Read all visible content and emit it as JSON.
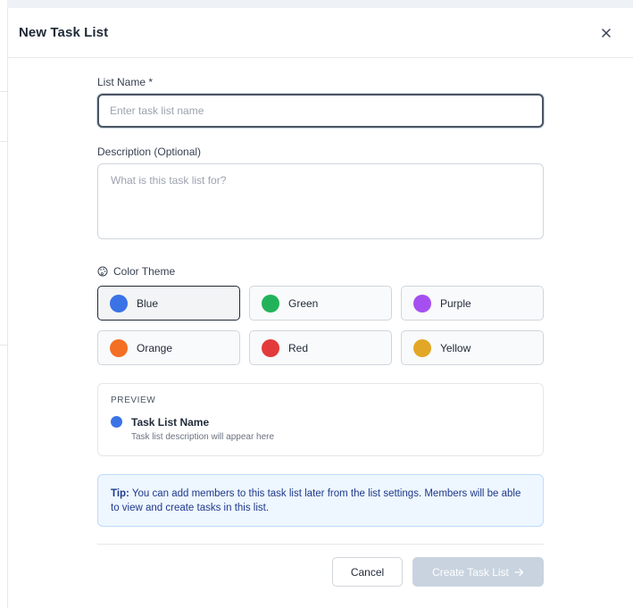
{
  "modal": {
    "title": "New Task List",
    "close_icon": "close-icon"
  },
  "form": {
    "name_label": "List Name *",
    "name_placeholder": "Enter task list name",
    "name_value": "",
    "description_label": "Description (Optional)",
    "description_placeholder": "What is this task list for?",
    "description_value": "",
    "color_label": "Color Theme",
    "color_icon": "palette-icon",
    "selected_color": "Blue",
    "colors": [
      {
        "label": "Blue",
        "hex": "#3b73e6"
      },
      {
        "label": "Green",
        "hex": "#22b35a"
      },
      {
        "label": "Purple",
        "hex": "#a54ff0"
      },
      {
        "label": "Orange",
        "hex": "#f36f24"
      },
      {
        "label": "Red",
        "hex": "#e33b3b"
      },
      {
        "label": "Yellow",
        "hex": "#e2a726"
      }
    ]
  },
  "preview": {
    "heading": "PREVIEW",
    "name": "Task List Name",
    "description": "Task list description will appear here",
    "dot_color": "#3b73e6"
  },
  "tip": {
    "prefix": "Tip:",
    "text": "You can add members to this task list later from the list settings. Members will be able to view and create tasks in this list."
  },
  "footer": {
    "cancel_label": "Cancel",
    "create_label": "Create Task List",
    "create_icon": "arrow-right-icon"
  }
}
